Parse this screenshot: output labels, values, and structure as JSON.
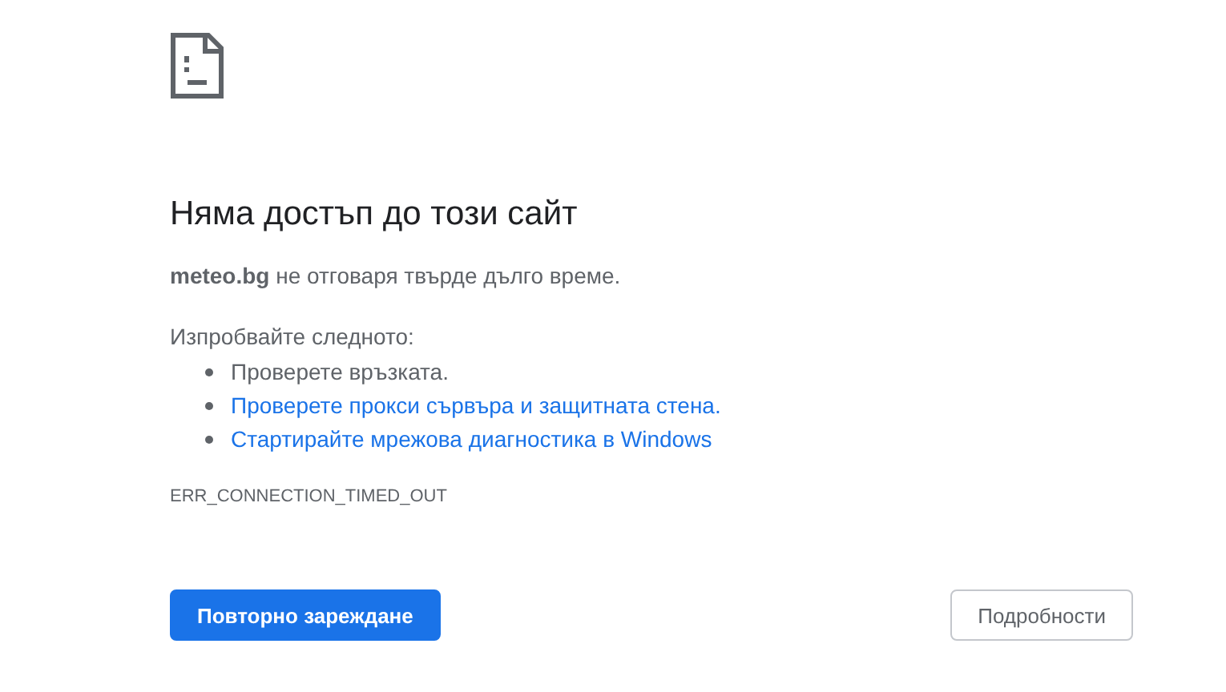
{
  "heading": "Няма достъп до този сайт",
  "message": "**meteo.bg** не отговаря твърде дълго време.",
  "suggestions_title": "Изпробвайте следното:",
  "suggestions": [
    {
      "kind": "text",
      "text": "Проверете връзката."
    },
    {
      "kind": "link",
      "text": "Проверете прокси сървъра и защитната стена."
    },
    {
      "kind": "link",
      "text": "Стартирайте мрежова диагностика в Windows"
    }
  ],
  "error_code": "ERR_CONNECTION_TIMED_OUT",
  "buttons": [
    {
      "kind": "primary",
      "label": "Повторно зареждане"
    },
    {
      "kind": "secondary",
      "label": "Подробности"
    }
  ]
}
